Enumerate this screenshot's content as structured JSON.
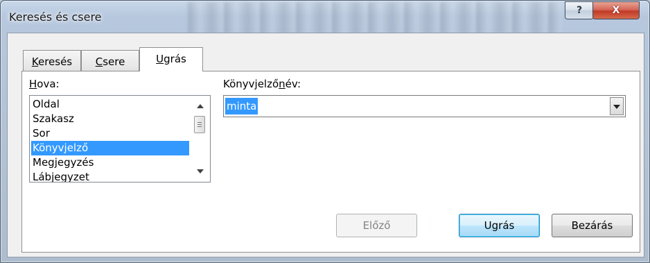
{
  "window": {
    "title": "Keresés és csere",
    "help_glyph": "?",
    "close_glyph": "X"
  },
  "tabs": [
    {
      "pre": "",
      "key": "K",
      "post": "eresés"
    },
    {
      "pre": "",
      "key": "C",
      "post": "sere"
    },
    {
      "pre": "",
      "key": "U",
      "post": "grás"
    }
  ],
  "goto": {
    "label_pre": "",
    "label_key": "H",
    "label_post": "ova:",
    "items": [
      "Oldal",
      "Szakasz",
      "Sor",
      "Könyvjelző",
      "Megjegyzés",
      "Lábjegyzet"
    ],
    "selected": "Könyvjelző",
    "name_label_pre": "Könyvjelző",
    "name_label_key": "n",
    "name_label_post": "év:",
    "name_value": "minta"
  },
  "buttons": {
    "prev": "Előző",
    "goto_pre": "U",
    "goto_key": "g",
    "goto_post": "rás",
    "close": "Bezárás"
  },
  "colors": {
    "selection": "#3399ff",
    "close_button": "#c23a28"
  }
}
